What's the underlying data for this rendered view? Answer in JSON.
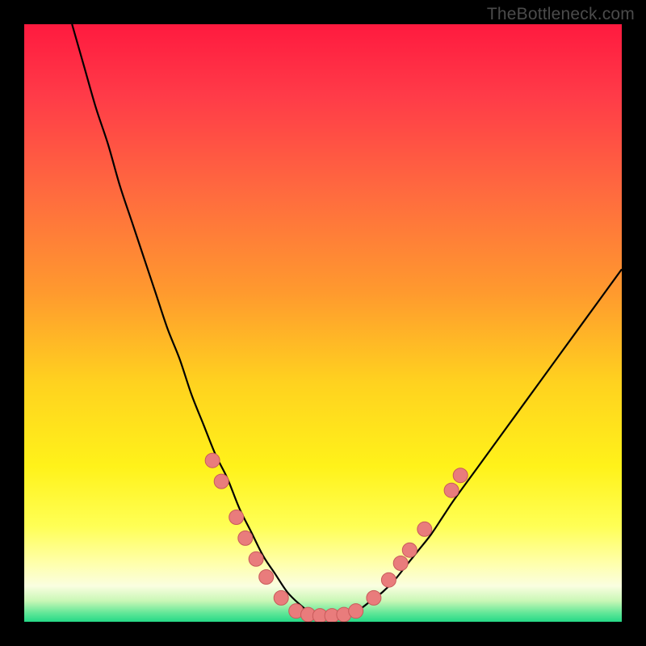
{
  "watermark": "TheBottleneck.com",
  "colors": {
    "frame": "#000000",
    "curve": "#000000",
    "dot_fill": "#e97c7c",
    "dot_stroke": "#c85a5a",
    "gradient_stops": [
      {
        "offset": 0.0,
        "color": "#ff1a3f"
      },
      {
        "offset": 0.12,
        "color": "#ff3b48"
      },
      {
        "offset": 0.28,
        "color": "#ff6a3f"
      },
      {
        "offset": 0.45,
        "color": "#ff9a2e"
      },
      {
        "offset": 0.6,
        "color": "#ffd21f"
      },
      {
        "offset": 0.74,
        "color": "#fff21a"
      },
      {
        "offset": 0.84,
        "color": "#ffff55"
      },
      {
        "offset": 0.9,
        "color": "#ffffa8"
      },
      {
        "offset": 0.94,
        "color": "#fafee0"
      },
      {
        "offset": 0.965,
        "color": "#c9f7b6"
      },
      {
        "offset": 0.985,
        "color": "#63e798"
      },
      {
        "offset": 1.0,
        "color": "#25d987"
      }
    ]
  },
  "chart_data": {
    "type": "line",
    "title": "",
    "xlabel": "",
    "ylabel": "",
    "xlim": [
      0,
      100
    ],
    "ylim": [
      0,
      100
    ],
    "grid": false,
    "legend": false,
    "series": [
      {
        "name": "bottleneck-curve",
        "x": [
          8,
          10,
          12,
          14,
          16,
          18,
          20,
          22,
          24,
          26,
          28,
          30,
          32,
          34,
          36,
          38,
          40,
          42,
          44,
          46,
          48,
          50,
          52,
          54,
          56,
          58,
          60,
          62,
          64,
          66,
          68,
          70,
          72,
          76,
          80,
          84,
          88,
          92,
          96,
          100
        ],
        "y": [
          100,
          93,
          86,
          80,
          73,
          67,
          61,
          55,
          49,
          44,
          38,
          33,
          28,
          24,
          19,
          15,
          11,
          8,
          5,
          3,
          1.5,
          1,
          1,
          1.2,
          2,
          3.5,
          5,
          7,
          9.5,
          12,
          14.5,
          17.5,
          20.5,
          26,
          31.5,
          37,
          42.5,
          48,
          53.5,
          59
        ]
      }
    ],
    "markers": [
      {
        "x": 31.5,
        "y": 27.0
      },
      {
        "x": 33.0,
        "y": 23.5
      },
      {
        "x": 35.5,
        "y": 17.5
      },
      {
        "x": 37.0,
        "y": 14.0
      },
      {
        "x": 38.8,
        "y": 10.5
      },
      {
        "x": 40.5,
        "y": 7.5
      },
      {
        "x": 43.0,
        "y": 4.0
      },
      {
        "x": 45.5,
        "y": 1.8
      },
      {
        "x": 47.5,
        "y": 1.2
      },
      {
        "x": 49.5,
        "y": 1.0
      },
      {
        "x": 51.5,
        "y": 1.0
      },
      {
        "x": 53.5,
        "y": 1.2
      },
      {
        "x": 55.5,
        "y": 1.8
      },
      {
        "x": 58.5,
        "y": 4.0
      },
      {
        "x": 61.0,
        "y": 7.0
      },
      {
        "x": 63.0,
        "y": 9.8
      },
      {
        "x": 64.5,
        "y": 12.0
      },
      {
        "x": 67.0,
        "y": 15.5
      },
      {
        "x": 71.5,
        "y": 22.0
      },
      {
        "x": 73.0,
        "y": 24.5
      }
    ],
    "dot_radius_px": 9
  }
}
